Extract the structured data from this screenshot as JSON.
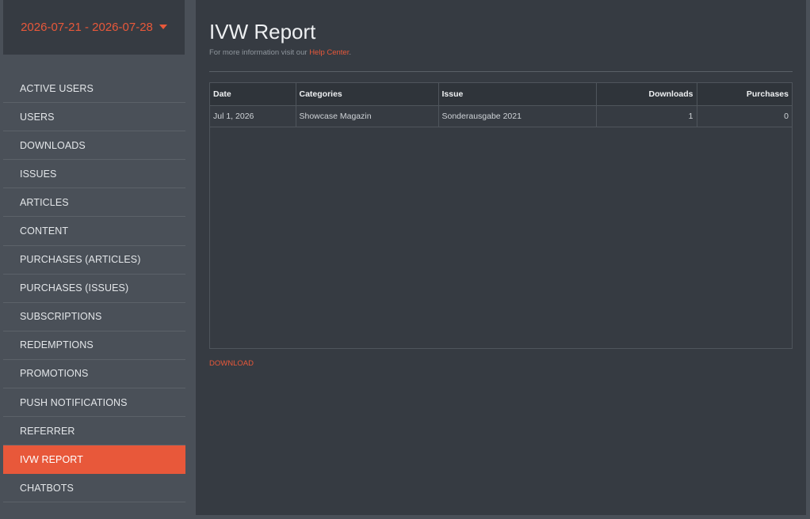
{
  "sidebar": {
    "date_range": "2026-07-21 - 2026-07-28",
    "items": [
      {
        "label": "ACTIVE USERS"
      },
      {
        "label": "USERS"
      },
      {
        "label": "DOWNLOADS"
      },
      {
        "label": "ISSUES"
      },
      {
        "label": "ARTICLES"
      },
      {
        "label": "CONTENT"
      },
      {
        "label": "PURCHASES (ARTICLES)"
      },
      {
        "label": "PURCHASES (ISSUES)"
      },
      {
        "label": "SUBSCRIPTIONS"
      },
      {
        "label": "REDEMPTIONS"
      },
      {
        "label": "PROMOTIONS"
      },
      {
        "label": "PUSH NOTIFICATIONS"
      },
      {
        "label": "REFERRER"
      },
      {
        "label": "IVW REPORT"
      },
      {
        "label": "CHATBOTS"
      }
    ],
    "active_item": "IVW REPORT"
  },
  "main": {
    "title": "IVW Report",
    "subtitle_prefix": "For more information visit our ",
    "help_link": "Help Center",
    "subtitle_suffix": ".",
    "table": {
      "columns": [
        "Date",
        "Categories",
        "Issue",
        "Downloads",
        "Purchases"
      ],
      "rows": [
        [
          "Jul 1, 2026",
          "Showcase Magazin",
          "Sonderausgabe 2021",
          "1",
          "0"
        ]
      ]
    },
    "download_label": "DOWNLOAD"
  },
  "colors": {
    "accent": "#e8583a",
    "panel": "#363b42",
    "background": "#4a5058"
  }
}
